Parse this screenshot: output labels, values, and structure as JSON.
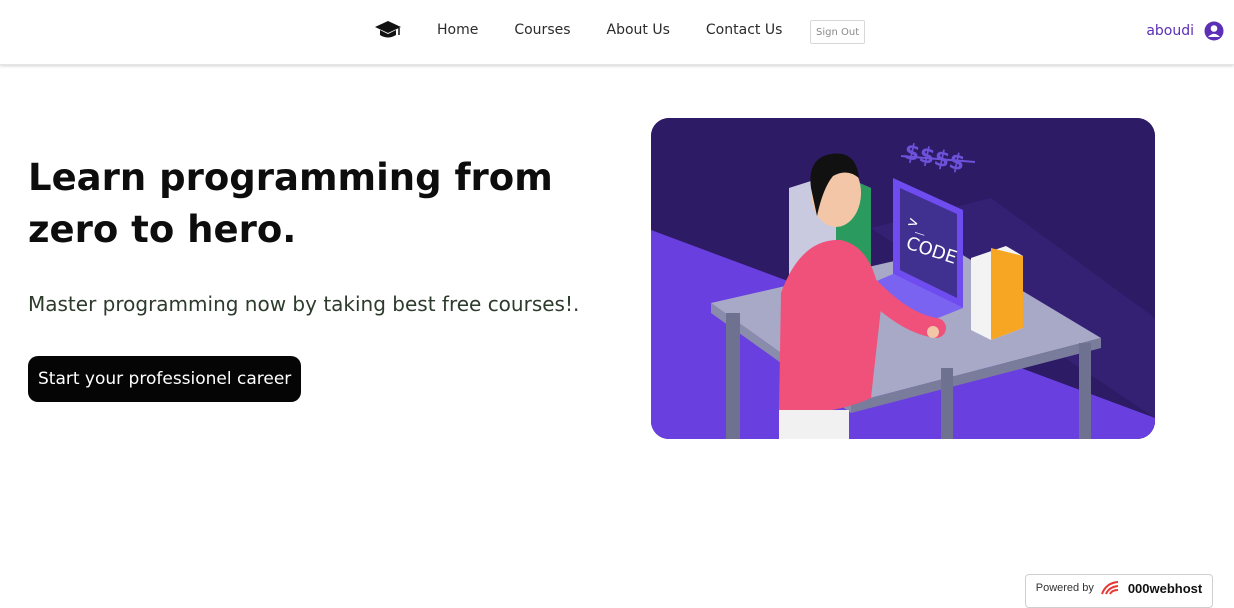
{
  "nav": {
    "logo_icon": "graduation-cap-icon",
    "links": [
      "Home",
      "Courses",
      "About Us",
      "Contact Us"
    ],
    "signout_label": "Sign Out",
    "username": "aboudi",
    "user_icon": "user-circle-icon",
    "accent_color": "#5b2fb6"
  },
  "hero": {
    "title": "Learn programming from zero to hero.",
    "subtitle": "Master programming now by taking best free courses!.",
    "cta_label": "Start your professionel career"
  },
  "illustration": {
    "money_text": "$$$$",
    "code_text": "CODE",
    "prompt_text": ">_"
  },
  "footer": {
    "powered_text": "Powered by",
    "brand": "000webhost"
  }
}
